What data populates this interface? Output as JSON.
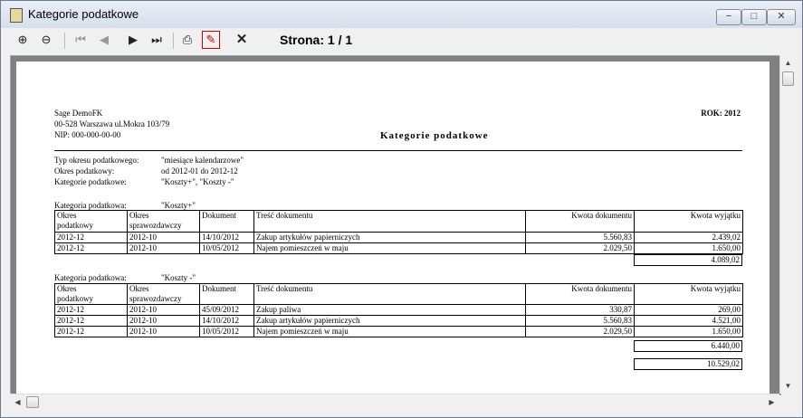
{
  "window": {
    "title": "Kategorie podatkowe",
    "controls": {
      "minimize": "−",
      "maximize": "□",
      "close": "✕"
    }
  },
  "toolbar": {
    "buttons": [
      {
        "name": "zoom-in-button",
        "icon": "zoom-in-icon",
        "glyph": "⊕"
      },
      {
        "name": "zoom-out-button",
        "icon": "zoom-out-icon",
        "glyph": "⊖"
      },
      {
        "name": "first-page-button",
        "icon": "first-page-icon",
        "glyph": "⏮"
      },
      {
        "name": "prev-page-button",
        "icon": "prev-page-icon",
        "glyph": "◀"
      },
      {
        "name": "next-page-button",
        "icon": "next-page-icon",
        "glyph": "▶"
      },
      {
        "name": "last-page-button",
        "icon": "last-page-icon",
        "glyph": "⏭"
      },
      {
        "name": "print-button",
        "icon": "printer-icon",
        "glyph": "⎙"
      },
      {
        "name": "pdf-export-button",
        "icon": "pdf-icon",
        "glyph": "✎"
      },
      {
        "name": "close-preview-button",
        "icon": "close-icon",
        "glyph": "✕"
      }
    ],
    "page_indicator": "Strona: 1 / 1"
  },
  "report": {
    "company": "Sage DemoFK",
    "address": "00-528 Warszawa ul.Mokra 103/79",
    "nip": "NIP: 000-000-00-00",
    "title": "Kategorie podatkowe",
    "year": "ROK: 2012",
    "params": [
      {
        "label": "Typ okresu podatkowego:",
        "value": "\"miesiące kalendarzowe\""
      },
      {
        "label": "Okres podatkowy:",
        "value": "od 2012-01 do 2012-12"
      },
      {
        "label": "Kategorie podatkowe:",
        "value": "\"Koszty+\", \"Koszty -\""
      }
    ],
    "columns": [
      "Okres\npodatkowy",
      "Okres\nsprawozdawczy",
      "Dokument",
      "Treść dokumentu",
      "Kwota dokumentu",
      "Kwota wyjątku"
    ],
    "sections": [
      {
        "label": "Kategoria podatkowa:",
        "name": "\"Koszty+\"",
        "rows": [
          [
            "2012-12",
            "2012-10",
            "14/10/2012",
            "Zakup artykułów papierniczych",
            "5.560,83",
            "2.439,02"
          ],
          [
            "2012-12",
            "2012-10",
            "10/05/2012",
            "Najem pomieszczeń w maju",
            "2.029,50",
            "1.650,00"
          ]
        ],
        "subtotal": "4.089,02"
      },
      {
        "label": "Kategoria podatkowa:",
        "name": "\"Koszty -\"",
        "rows": [
          [
            "2012-12",
            "2012-10",
            "45/09/2012",
            "Zakup paliwa",
            "330,87",
            "269,00"
          ],
          [
            "2012-12",
            "2012-10",
            "14/10/2012",
            "Zakup artykułów papierniczych",
            "5.560,83",
            "4.521,00"
          ],
          [
            "2012-12",
            "2012-10",
            "10/05/2012",
            "Najem pomieszczeń w maju",
            "2.029,50",
            "1.650,00"
          ]
        ],
        "subtotal": "6.440,00"
      }
    ],
    "grand_total": "10.529,02"
  },
  "scrollbars": {
    "up": "▲",
    "down": "▼",
    "left": "◀",
    "right": "▶"
  }
}
